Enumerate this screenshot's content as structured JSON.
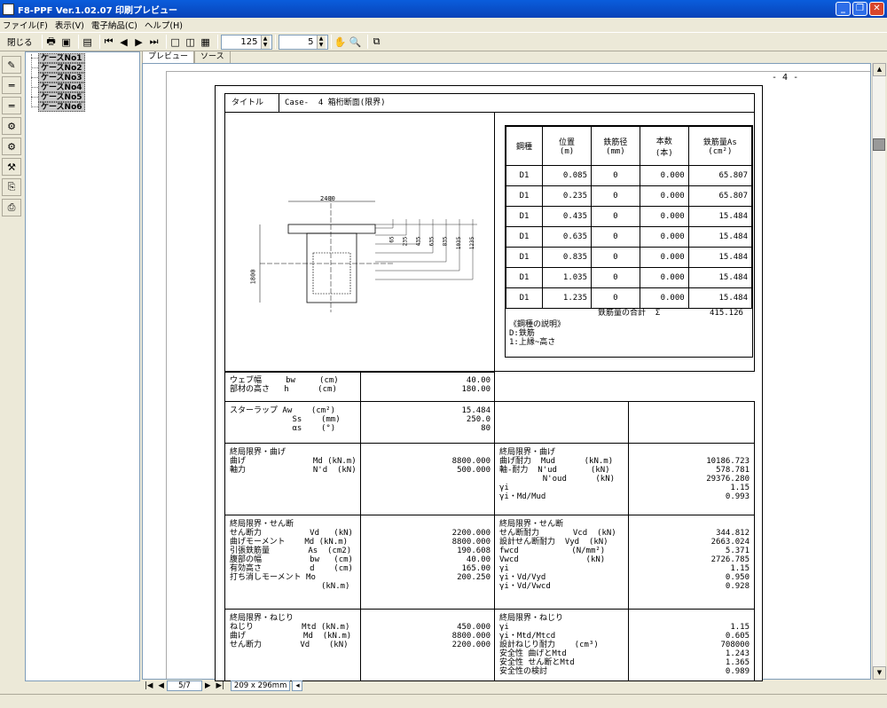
{
  "window": {
    "title": "F8-PPF Ver.1.02.07 印刷プレビュー"
  },
  "menu": [
    "ファイル(F)",
    "表示(V)",
    "電子納品(C)",
    "ヘルプ(H)"
  ],
  "toolbar": {
    "close_label": "閉じる",
    "zoom_value": "125",
    "page_value": "5"
  },
  "tree": {
    "items": [
      "ケースNo1",
      "ケースNo2",
      "ケースNo3",
      "ケースNo4",
      "ケースNo5",
      "ケースNo6"
    ]
  },
  "tabs": [
    "プレビュー",
    "ソース"
  ],
  "page_number": "- 4 -",
  "bottom": {
    "page_indicator": "5/7",
    "paper_size": "209 x 296mm"
  },
  "doc": {
    "title_label": "タイトル",
    "title_value": "Case-  4 箱桁断面(限界)",
    "drawing": {
      "width_label": "2400",
      "height_label": "1800",
      "dims": [
        "65",
        "235",
        "435",
        "635",
        "835",
        "1035",
        "1235"
      ]
    },
    "rebar": {
      "headers": [
        "鋼種",
        "位置\n(m)",
        "鉄筋径\n(mm)",
        "本数\n(本)",
        "鉄筋量As\n(cm²)"
      ],
      "rows": [
        [
          "D1",
          "0.085",
          "0",
          "0.000",
          "65.807"
        ],
        [
          "D1",
          "0.235",
          "0",
          "0.000",
          "65.807"
        ],
        [
          "D1",
          "0.435",
          "0",
          "0.000",
          "15.484"
        ],
        [
          "D1",
          "0.635",
          "0",
          "0.000",
          "15.484"
        ],
        [
          "D1",
          "0.835",
          "0",
          "0.000",
          "15.484"
        ],
        [
          "D1",
          "1.035",
          "0",
          "0.000",
          "15.484"
        ],
        [
          "D1",
          "1.235",
          "0",
          "0.000",
          "15.484"
        ]
      ],
      "total_label": "鉄筋量の合計  Σ",
      "total_value": "415.126",
      "note": "《鋼種の説明》\nD:鉄筋\n1:上縁~高さ"
    },
    "web": {
      "label": "ウェブ幅     bw     (cm)\n部材の高さ   h      (cm)",
      "value": "40.00\n180.00"
    },
    "stirrup": {
      "label": "スターラップ Aw    (cm²)\n             Ss    (mm)\n             αs    (°)",
      "value": "15.484\n250.0\n80"
    },
    "bending": {
      "label": "終局限界・曲げ\n曲げ              Md (kN.m)\n軸力              N'd  (kN)",
      "value": "\n8800.000\n500.000",
      "r_label": "終局限界・曲げ\n曲げ耐力  Mud      (kN.m)\n軸-耐力  N'ud       (kN)\n         N'oud      (kN)\nγi\nγi・Md/Mud",
      "r_value": "\n10186.723\n578.781\n29376.280\n1.15\n0.993"
    },
    "shear": {
      "label": "終局限界・せん断\nせん断力          Vd   (kN)\n曲げモーメント    Md (kN.m)\n引張鉄筋量        As  (cm2)\n腹部の幅          bw   (cm)\n有効高さ          d    (cm)\n打ち消しモーメント Mo\n                   (kN.m)",
      "value": "\n2200.000\n8800.000\n190.608\n40.00\n165.00\n200.250",
      "r_label": "終局限界・せん断\nせん断耐力       Vcd  (kN)\n設計せん断耐力  Vyd  (kN)\nfwcd           (N/mm²)\nVwcd              (kN)\nγi\nγi・Vd/Vyd\nγi・Vd/Vwcd",
      "r_value": "\n344.812\n2663.024\n5.371\n2726.785\n1.15\n0.950\n0.928"
    },
    "torsion": {
      "label": "終局限界・ねじり\nねじり          Mtd (kN.m)\n曲げ            Md  (kN.m)\nせん断力        Vd    (kN)",
      "value": "\n450.000\n8800.000\n2200.000",
      "r_label": "終局限界・ねじり\nγi\nγi・Mtd/Mtcd\n設計ねじり耐力    (cm³)\n安全性 曲げとMtd\n安全性 せん断とMtd\n安全性の検討",
      "r_value": "\n1.15\n0.605\n708000\n1.243\n1.365\n0.989"
    }
  }
}
